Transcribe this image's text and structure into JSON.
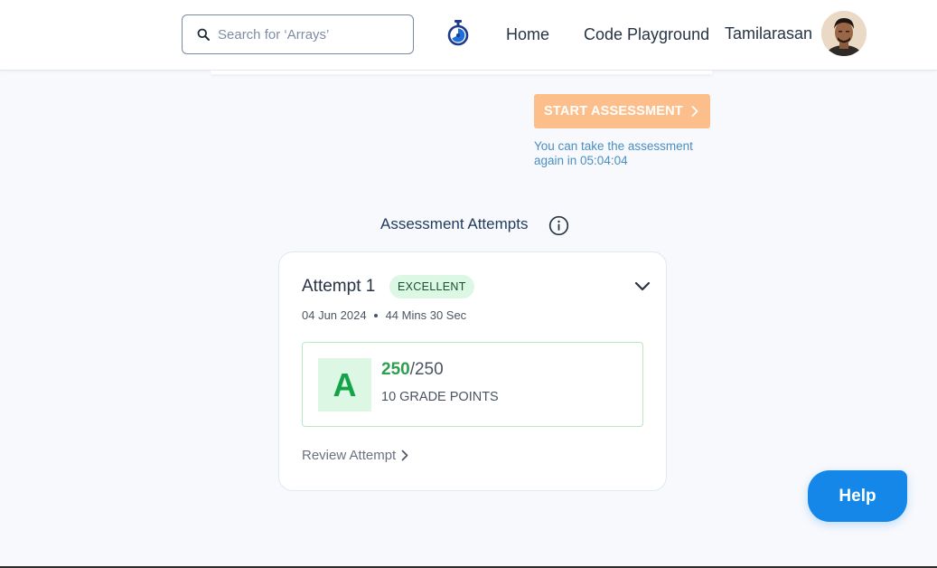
{
  "header": {
    "search": {
      "placeholder": "Search for ‘Arrays’"
    },
    "nav": {
      "home": "Home",
      "code_playground": "Code Playground"
    },
    "user": {
      "name": "Tamilarasan"
    }
  },
  "assessment": {
    "start_button": "START ASSESSMENT",
    "retake_message": "You can take the assessment again in 05:04:04"
  },
  "attempts": {
    "title": "Assessment Attempts",
    "items": [
      {
        "title": "Attempt 1",
        "badge": "EXCELLENT",
        "date": "04 Jun 2024",
        "duration": "44 Mins 30 Sec",
        "grade": "A",
        "score": "250",
        "score_separator": "/",
        "total": "250",
        "grade_points": "10 GRADE POINTS",
        "review_label": "Review Attempt"
      }
    ]
  },
  "help": {
    "label": "Help"
  },
  "colors": {
    "accent_orange": "#fcbf8c",
    "success_green": "#15a34a",
    "help_blue": "#1487e8",
    "link_blue": "#4a8ec0"
  },
  "icons": [
    "search-icon",
    "stopwatch-icon",
    "chevron-right-icon",
    "info-icon",
    "chevron-down-icon"
  ]
}
